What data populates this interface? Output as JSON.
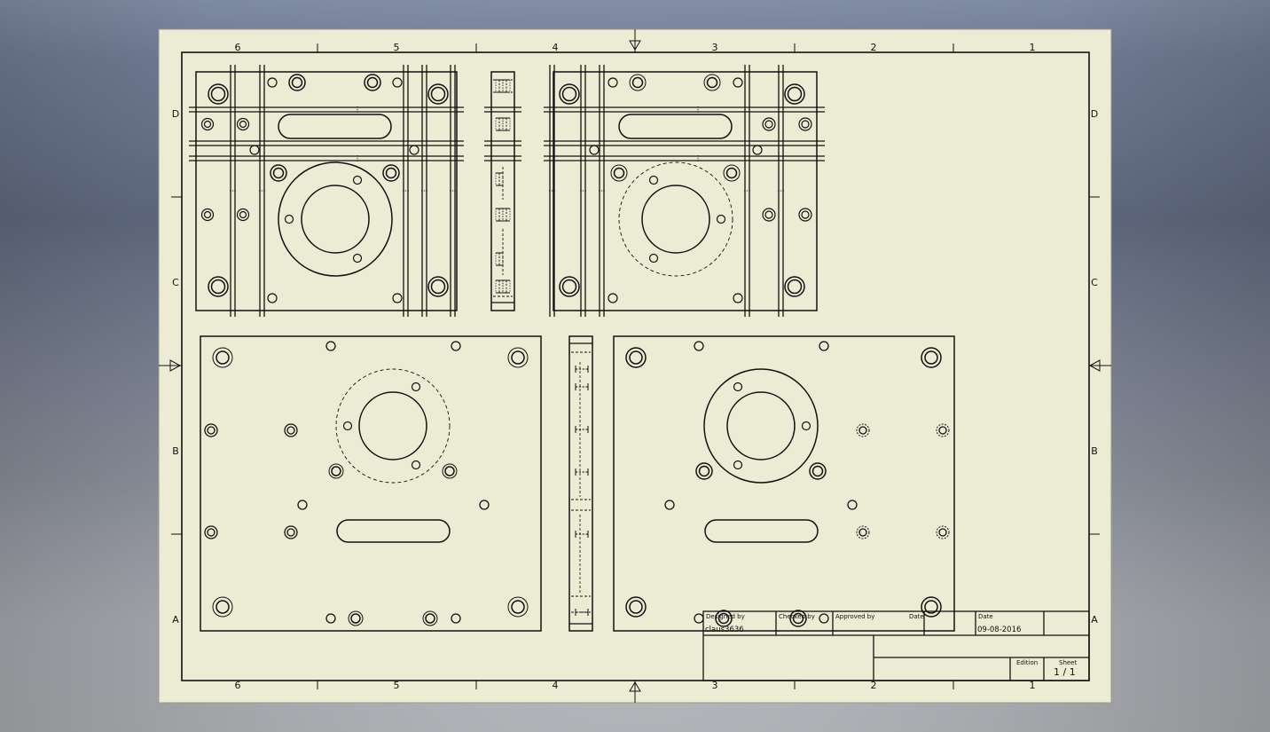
{
  "drawing": {
    "zones_top": [
      "6",
      "5",
      "4",
      "3",
      "2",
      "1"
    ],
    "zones_side": [
      "D",
      "C",
      "B",
      "A"
    ]
  },
  "title_block": {
    "designed_by_label": "Designed by",
    "designed_by_value": "claus3636",
    "checked_by_label": "Checked by",
    "approved_by_label": "Approved by",
    "date_label_1": "Date",
    "date_label_2": "Date",
    "date_value": "09-08-2016",
    "edition_label": "Edition",
    "sheet_label": "Sheet",
    "sheet_value": "1 / 1"
  },
  "colors": {
    "paper": "#ececd5",
    "line": "#111111",
    "background": "#6d7890"
  }
}
